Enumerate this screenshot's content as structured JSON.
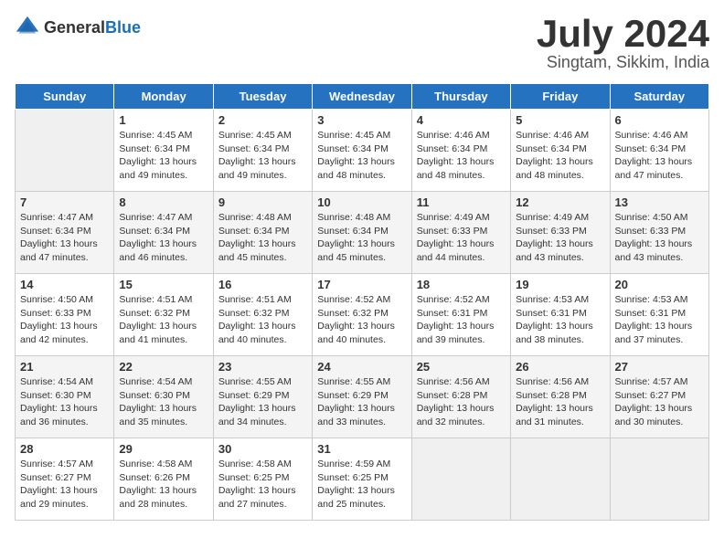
{
  "header": {
    "logo_general": "General",
    "logo_blue": "Blue",
    "month": "July 2024",
    "location": "Singtam, Sikkim, India"
  },
  "days_of_week": [
    "Sunday",
    "Monday",
    "Tuesday",
    "Wednesday",
    "Thursday",
    "Friday",
    "Saturday"
  ],
  "weeks": [
    [
      {
        "day": "",
        "empty": true
      },
      {
        "day": "1",
        "sunrise": "Sunrise: 4:45 AM",
        "sunset": "Sunset: 6:34 PM",
        "daylight": "Daylight: 13 hours and 49 minutes."
      },
      {
        "day": "2",
        "sunrise": "Sunrise: 4:45 AM",
        "sunset": "Sunset: 6:34 PM",
        "daylight": "Daylight: 13 hours and 49 minutes."
      },
      {
        "day": "3",
        "sunrise": "Sunrise: 4:45 AM",
        "sunset": "Sunset: 6:34 PM",
        "daylight": "Daylight: 13 hours and 48 minutes."
      },
      {
        "day": "4",
        "sunrise": "Sunrise: 4:46 AM",
        "sunset": "Sunset: 6:34 PM",
        "daylight": "Daylight: 13 hours and 48 minutes."
      },
      {
        "day": "5",
        "sunrise": "Sunrise: 4:46 AM",
        "sunset": "Sunset: 6:34 PM",
        "daylight": "Daylight: 13 hours and 48 minutes."
      },
      {
        "day": "6",
        "sunrise": "Sunrise: 4:46 AM",
        "sunset": "Sunset: 6:34 PM",
        "daylight": "Daylight: 13 hours and 47 minutes."
      }
    ],
    [
      {
        "day": "7",
        "sunrise": "Sunrise: 4:47 AM",
        "sunset": "Sunset: 6:34 PM",
        "daylight": "Daylight: 13 hours and 47 minutes."
      },
      {
        "day": "8",
        "sunrise": "Sunrise: 4:47 AM",
        "sunset": "Sunset: 6:34 PM",
        "daylight": "Daylight: 13 hours and 46 minutes."
      },
      {
        "day": "9",
        "sunrise": "Sunrise: 4:48 AM",
        "sunset": "Sunset: 6:34 PM",
        "daylight": "Daylight: 13 hours and 45 minutes."
      },
      {
        "day": "10",
        "sunrise": "Sunrise: 4:48 AM",
        "sunset": "Sunset: 6:34 PM",
        "daylight": "Daylight: 13 hours and 45 minutes."
      },
      {
        "day": "11",
        "sunrise": "Sunrise: 4:49 AM",
        "sunset": "Sunset: 6:33 PM",
        "daylight": "Daylight: 13 hours and 44 minutes."
      },
      {
        "day": "12",
        "sunrise": "Sunrise: 4:49 AM",
        "sunset": "Sunset: 6:33 PM",
        "daylight": "Daylight: 13 hours and 43 minutes."
      },
      {
        "day": "13",
        "sunrise": "Sunrise: 4:50 AM",
        "sunset": "Sunset: 6:33 PM",
        "daylight": "Daylight: 13 hours and 43 minutes."
      }
    ],
    [
      {
        "day": "14",
        "sunrise": "Sunrise: 4:50 AM",
        "sunset": "Sunset: 6:33 PM",
        "daylight": "Daylight: 13 hours and 42 minutes."
      },
      {
        "day": "15",
        "sunrise": "Sunrise: 4:51 AM",
        "sunset": "Sunset: 6:32 PM",
        "daylight": "Daylight: 13 hours and 41 minutes."
      },
      {
        "day": "16",
        "sunrise": "Sunrise: 4:51 AM",
        "sunset": "Sunset: 6:32 PM",
        "daylight": "Daylight: 13 hours and 40 minutes."
      },
      {
        "day": "17",
        "sunrise": "Sunrise: 4:52 AM",
        "sunset": "Sunset: 6:32 PM",
        "daylight": "Daylight: 13 hours and 40 minutes."
      },
      {
        "day": "18",
        "sunrise": "Sunrise: 4:52 AM",
        "sunset": "Sunset: 6:31 PM",
        "daylight": "Daylight: 13 hours and 39 minutes."
      },
      {
        "day": "19",
        "sunrise": "Sunrise: 4:53 AM",
        "sunset": "Sunset: 6:31 PM",
        "daylight": "Daylight: 13 hours and 38 minutes."
      },
      {
        "day": "20",
        "sunrise": "Sunrise: 4:53 AM",
        "sunset": "Sunset: 6:31 PM",
        "daylight": "Daylight: 13 hours and 37 minutes."
      }
    ],
    [
      {
        "day": "21",
        "sunrise": "Sunrise: 4:54 AM",
        "sunset": "Sunset: 6:30 PM",
        "daylight": "Daylight: 13 hours and 36 minutes."
      },
      {
        "day": "22",
        "sunrise": "Sunrise: 4:54 AM",
        "sunset": "Sunset: 6:30 PM",
        "daylight": "Daylight: 13 hours and 35 minutes."
      },
      {
        "day": "23",
        "sunrise": "Sunrise: 4:55 AM",
        "sunset": "Sunset: 6:29 PM",
        "daylight": "Daylight: 13 hours and 34 minutes."
      },
      {
        "day": "24",
        "sunrise": "Sunrise: 4:55 AM",
        "sunset": "Sunset: 6:29 PM",
        "daylight": "Daylight: 13 hours and 33 minutes."
      },
      {
        "day": "25",
        "sunrise": "Sunrise: 4:56 AM",
        "sunset": "Sunset: 6:28 PM",
        "daylight": "Daylight: 13 hours and 32 minutes."
      },
      {
        "day": "26",
        "sunrise": "Sunrise: 4:56 AM",
        "sunset": "Sunset: 6:28 PM",
        "daylight": "Daylight: 13 hours and 31 minutes."
      },
      {
        "day": "27",
        "sunrise": "Sunrise: 4:57 AM",
        "sunset": "Sunset: 6:27 PM",
        "daylight": "Daylight: 13 hours and 30 minutes."
      }
    ],
    [
      {
        "day": "28",
        "sunrise": "Sunrise: 4:57 AM",
        "sunset": "Sunset: 6:27 PM",
        "daylight": "Daylight: 13 hours and 29 minutes."
      },
      {
        "day": "29",
        "sunrise": "Sunrise: 4:58 AM",
        "sunset": "Sunset: 6:26 PM",
        "daylight": "Daylight: 13 hours and 28 minutes."
      },
      {
        "day": "30",
        "sunrise": "Sunrise: 4:58 AM",
        "sunset": "Sunset: 6:25 PM",
        "daylight": "Daylight: 13 hours and 27 minutes."
      },
      {
        "day": "31",
        "sunrise": "Sunrise: 4:59 AM",
        "sunset": "Sunset: 6:25 PM",
        "daylight": "Daylight: 13 hours and 25 minutes."
      },
      {
        "day": "",
        "empty": true
      },
      {
        "day": "",
        "empty": true
      },
      {
        "day": "",
        "empty": true
      }
    ]
  ]
}
